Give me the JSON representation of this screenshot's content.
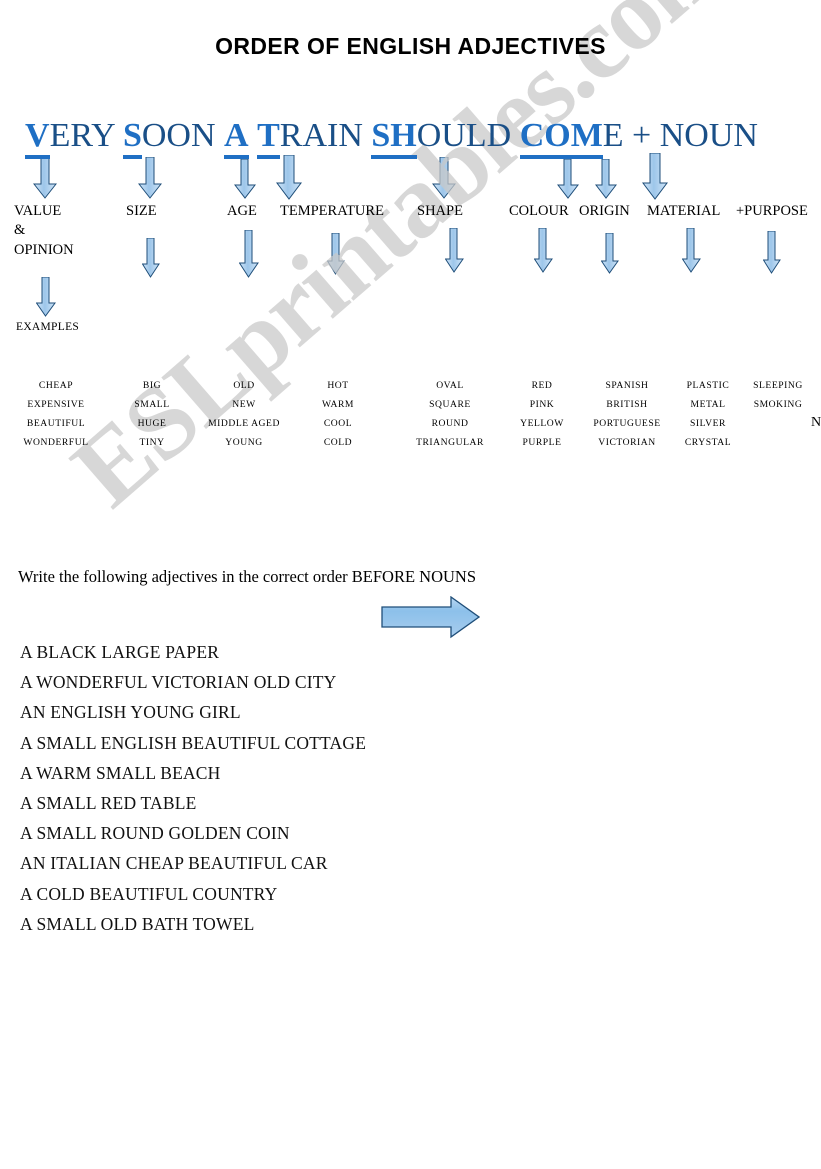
{
  "document": {
    "title": "ORDER OF ENGLISH ADJECTIVES",
    "watermark": "ESLprintables.com",
    "stray_char": "N"
  },
  "mnemonic": {
    "full_text": "VERY SOON A TRAIN SHOULD COME + NOUN",
    "segments": [
      {
        "key": "V",
        "rest": "ERY "
      },
      {
        "key": "S",
        "rest": "OON "
      },
      {
        "key": "A",
        "rest": " "
      },
      {
        "key": "T",
        "rest": "RAIN "
      },
      {
        "key": "SH",
        "rest": "OULD "
      },
      {
        "key": "COM",
        "rest": "E + NOUN"
      }
    ]
  },
  "categories": [
    {
      "label": "VALUE",
      "label2": "&",
      "label3": "OPINION"
    },
    {
      "label": "SIZE"
    },
    {
      "label": "AGE"
    },
    {
      "label": "TEMPERATURE"
    },
    {
      "label": "SHAPE"
    },
    {
      "label": "COLOUR"
    },
    {
      "label": "ORIGIN"
    },
    {
      "label": "MATERIAL"
    },
    {
      "label": "+PURPOSE"
    }
  ],
  "examples_label": "EXAMPLES",
  "example_columns": [
    {
      "category": "VALUE & OPINION",
      "words": [
        "CHEAP",
        "EXPENSIVE",
        "BEAUTIFUL",
        "WONDERFUL"
      ]
    },
    {
      "category": "SIZE",
      "words": [
        "BIG",
        "SMALL",
        "HUGE",
        "TINY"
      ]
    },
    {
      "category": "AGE",
      "words": [
        "OLD",
        "NEW",
        "MIDDLE AGED",
        "YOUNG"
      ]
    },
    {
      "category": "TEMPERATURE",
      "words": [
        "HOT",
        "WARM",
        "COOL",
        "COLD"
      ]
    },
    {
      "category": "SHAPE",
      "words": [
        "OVAL",
        "SQUARE",
        "ROUND",
        "TRIANGULAR"
      ]
    },
    {
      "category": "COLOUR",
      "words": [
        "RED",
        "PINK",
        "YELLOW",
        "PURPLE"
      ]
    },
    {
      "category": "ORIGIN",
      "words": [
        "SPANISH",
        "BRITISH",
        "PORTUGUESE",
        "VICTORIAN"
      ]
    },
    {
      "category": "MATERIAL",
      "words": [
        "PLASTIC",
        "METAL",
        "SILVER",
        "CRYSTAL"
      ]
    },
    {
      "category": "+PURPOSE",
      "words": [
        "SLEEPING",
        "SMOKING",
        "",
        ""
      ]
    }
  ],
  "exercise": {
    "instruction": "Write the following adjectives in the correct order BEFORE NOUNS",
    "items": [
      "A BLACK LARGE PAPER",
      "A WONDERFUL VICTORIAN OLD CITY",
      "AN ENGLISH YOUNG GIRL",
      "A SMALL ENGLISH BEAUTIFUL COTTAGE",
      "A WARM SMALL BEACH",
      "A SMALL RED TABLE",
      "A SMALL ROUND GOLDEN COIN",
      "AN ITALIAN CHEAP BEAUTIFUL CAR",
      "A COLD BEAUTIFUL COUNTRY",
      " A SMALL OLD BATH TOWEL"
    ]
  },
  "colors": {
    "arrow_fill": "#9dc6ea",
    "arrow_fill_light": "#cfe4f7",
    "arrow_stroke": "#1f4e79",
    "mnemonic_blue": "#17508f",
    "mnemonic_key_blue": "#1f6fc4",
    "watermark_gray": "#c9c9c9"
  }
}
